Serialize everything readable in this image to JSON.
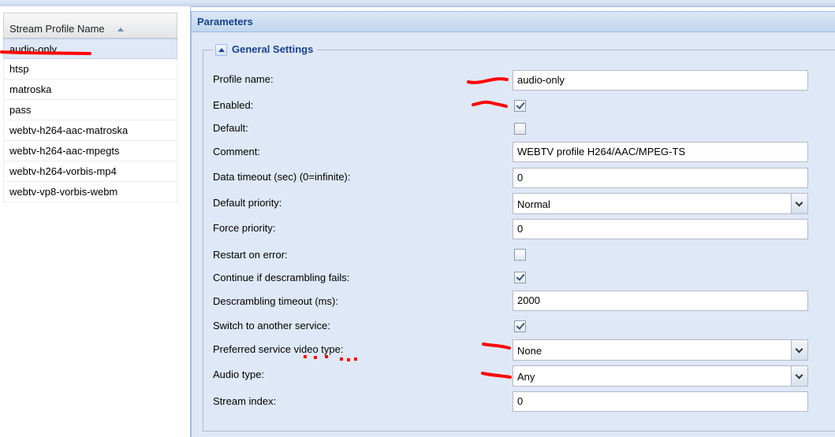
{
  "grid": {
    "column_header": "Stream Profile Name",
    "rows": [
      "audio-only",
      "htsp",
      "matroska",
      "pass",
      "webtv-h264-aac-matroska",
      "webtv-h264-aac-mpegts",
      "webtv-h264-vorbis-mp4",
      "webtv-vp8-vorbis-webm"
    ],
    "selected_row": "audio-only"
  },
  "panel": {
    "title": "Parameters",
    "fieldset_title": "General Settings"
  },
  "fields": {
    "profile_name": {
      "label": "Profile name:",
      "value": "audio-only"
    },
    "enabled": {
      "label": "Enabled:",
      "checked": true
    },
    "default": {
      "label": "Default:",
      "checked": false
    },
    "comment": {
      "label": "Comment:",
      "value": "WEBTV profile H264/AAC/MPEG-TS"
    },
    "data_timeout": {
      "label": "Data timeout (sec) (0=infinite):",
      "value": "0"
    },
    "default_priority": {
      "label": "Default priority:",
      "value": "Normal"
    },
    "force_priority": {
      "label": "Force priority:",
      "value": "0"
    },
    "restart_on_error": {
      "label": "Restart on error:",
      "checked": false
    },
    "continue_descrambling": {
      "label": "Continue if descrambling fails:",
      "checked": true
    },
    "descrambling_timeout": {
      "label": "Descrambling timeout (ms):",
      "value": "2000"
    },
    "switch_service": {
      "label": "Switch to another service:",
      "checked": true
    },
    "preferred_video_type": {
      "label": "Preferred service video type:",
      "value": "None"
    },
    "audio_type": {
      "label": "Audio type:",
      "value": "Any"
    },
    "stream_index": {
      "label": "Stream index:",
      "value": "0"
    }
  },
  "colors": {
    "annotation": "#ff0000",
    "header_text": "#15428b",
    "panel_bg": "#dfe8f6"
  }
}
